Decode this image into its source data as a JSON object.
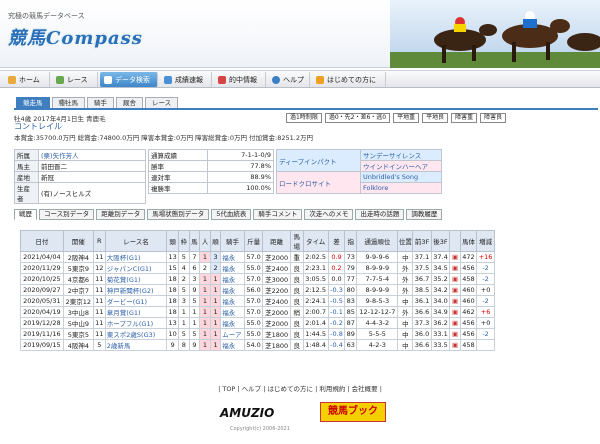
{
  "header": {
    "tagline": "究極の競馬データベース",
    "logo": "競馬Compass"
  },
  "nav": {
    "items": [
      "ホーム",
      "レース",
      "データ検索",
      "成績速報",
      "的中情報",
      "ヘルプ",
      "はじめての方に"
    ],
    "active": 2
  },
  "subtabs": [
    "競走馬",
    "種牡馬",
    "騎手",
    "厩舎",
    "レース"
  ],
  "horse": {
    "meta": "牡4歳 2017年4月1日生 青鹿毛",
    "name": "コントレイル",
    "earnings": "本賞金:35700.0万円 総賞金:74800.0万円 障害本賞金:0万円 障害総賞金:0万円 付加賞金:8251.2万円",
    "buttons": [
      "過1時制限",
      "過0・先2・差6・逃0",
      "平地重",
      "平地良",
      "障害重",
      "障害良"
    ],
    "profile": [
      [
        "所属",
        "(栗)矢作芳人"
      ],
      [
        "馬主",
        "前田晋二"
      ],
      [
        "産地",
        "新冠"
      ],
      [
        "生産者",
        "(有)ノースヒルズ"
      ]
    ],
    "stats": [
      [
        "通算成績",
        "7-1-1-0/9"
      ],
      [
        "勝率",
        "77.8%"
      ],
      [
        "連対率",
        "88.9%"
      ],
      [
        "複勝率",
        "100.0%"
      ]
    ],
    "pedigree": {
      "sire": "ディープインパクト",
      "sire_sire": "サンデーサイレンス",
      "sire_dam": "ウインドインハーヘア",
      "dam": "ロードクロサイト",
      "dam_sire": "Unbridled's Song",
      "dam_dam": "Folklore"
    }
  },
  "tabs2": [
    "戦歴",
    "コース別データ",
    "距離別データ",
    "馬場状態別データ",
    "5代血統表",
    "騎手コメント",
    "次走へのメモ",
    "出走時の話題",
    "調教履歴"
  ],
  "table": {
    "headers": [
      "日付",
      "開催",
      "R",
      "レース名",
      "頭",
      "枠",
      "馬",
      "人",
      "順",
      "騎手",
      "斤量",
      "距離",
      "馬場",
      "タイム",
      "差",
      "指",
      "通過順位",
      "位置",
      "前3F",
      "後3F",
      "",
      "馬体",
      "増減"
    ],
    "rows": [
      [
        "2021/04/04",
        "2阪神4",
        "11",
        "大阪杯(G1)",
        "13",
        "5",
        "7",
        "1",
        "3",
        "福永",
        "57.0",
        "芝2000",
        "重",
        "2:02.5",
        "0.9",
        "73",
        "9-9-9-6",
        "中",
        "37.1",
        "37.4",
        "",
        "472",
        "+16"
      ],
      [
        "2020/11/29",
        "5東京9",
        "12",
        "ジャパンC(G1)",
        "15",
        "4",
        "6",
        "2",
        "2",
        "福永",
        "55.0",
        "芝2400",
        "良",
        "2:23.1",
        "0.2",
        "79",
        "8-9-9-9",
        "外",
        "37.5",
        "34.5",
        "",
        "456",
        "-2"
      ],
      [
        "2020/10/25",
        "4京都6",
        "11",
        "菊花賞(G1)",
        "18",
        "2",
        "3",
        "1",
        "1",
        "福永",
        "57.0",
        "芝3000",
        "良",
        "3:05.5",
        "0.0",
        "77",
        "7-7-5-4",
        "外",
        "36.7",
        "35.2",
        "",
        "458",
        "-2"
      ],
      [
        "2020/09/27",
        "2中京7",
        "11",
        "神戸新聞杯(G2)",
        "18",
        "5",
        "9",
        "1",
        "1",
        "福永",
        "56.0",
        "芝2200",
        "良",
        "2:12.5",
        "-0.3",
        "80",
        "8-9-9-9",
        "外",
        "38.5",
        "34.2",
        "",
        "460",
        "+0"
      ],
      [
        "2020/05/31",
        "2東京12",
        "11",
        "ダービー(G1)",
        "18",
        "3",
        "5",
        "1",
        "1",
        "福永",
        "57.0",
        "芝2400",
        "良",
        "2:24.1",
        "-0.5",
        "83",
        "9-8-5-3",
        "中",
        "36.1",
        "34.0",
        "",
        "460",
        "-2"
      ],
      [
        "2020/04/19",
        "3中山8",
        "11",
        "皐月賞(G1)",
        "18",
        "1",
        "1",
        "1",
        "1",
        "福永",
        "57.0",
        "芝2000",
        "稍",
        "2:00.7",
        "-0.1",
        "85",
        "12-12-12-7",
        "外",
        "36.6",
        "34.9",
        "",
        "462",
        "+6"
      ],
      [
        "2019/12/28",
        "5中山9",
        "11",
        "ホープフル(G1)",
        "13",
        "1",
        "1",
        "1",
        "1",
        "福永",
        "55.0",
        "芝2000",
        "良",
        "2:01.4",
        "-0.2",
        "87",
        "4-4-3-2",
        "中",
        "37.3",
        "36.2",
        "",
        "456",
        "+0"
      ],
      [
        "2019/11/16",
        "5東京5",
        "11",
        "東スポ2歳S(G3)",
        "10",
        "5",
        "5",
        "1",
        "1",
        "ムーア",
        "55.0",
        "芝1800",
        "良",
        "1:44.5",
        "-0.8",
        "89",
        "5-5-5",
        "中",
        "36.0",
        "33.1",
        "",
        "456",
        "-2"
      ],
      [
        "2019/09/15",
        "4阪神4",
        "5",
        "2歳新馬",
        "9",
        "8",
        "9",
        "1",
        "1",
        "福永",
        "54.0",
        "芝1800",
        "良",
        "1:48.4",
        "-0.4",
        "63",
        "4-2-3",
        "中",
        "36.6",
        "33.5",
        "",
        "458",
        ""
      ]
    ]
  },
  "footer": {
    "links": "| TOP | ヘルプ | はじめての方に | 利用規約 | 会社概要 |",
    "logo_left": "AMUZIO",
    "logo_right": "競馬ブック",
    "copyright": "Copyright(c) 2006-2021"
  },
  "colors": {
    "accent": "#3f7fc0",
    "link": "#2b5fa8"
  }
}
